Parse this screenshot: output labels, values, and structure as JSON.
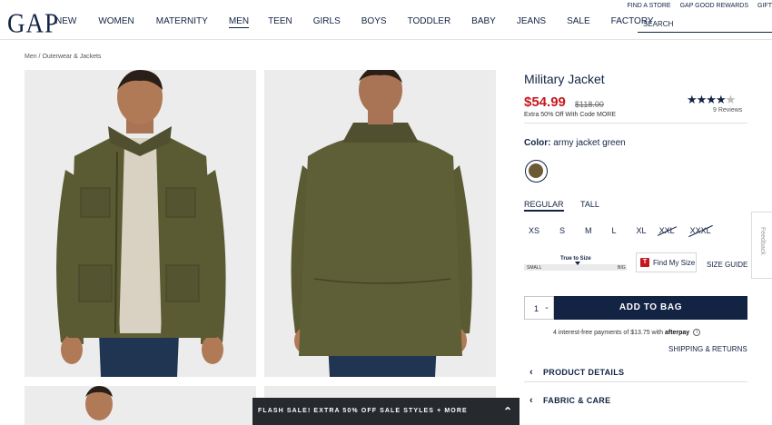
{
  "header": {
    "logo": "GAP",
    "nav": [
      "NEW",
      "WOMEN",
      "MATERNITY",
      "MEN",
      "TEEN",
      "GIRLS",
      "BOYS",
      "TODDLER",
      "BABY",
      "JEANS",
      "SALE",
      "FACTORY"
    ],
    "active_nav": "MEN",
    "top_links": [
      "FIND A STORE",
      "GAP GOOD REWARDS",
      "GIFT"
    ],
    "search_placeholder": "SEARCH"
  },
  "breadcrumb": "Men / Outerwear & Jackets",
  "product": {
    "title": "Military Jacket",
    "price": "$54.99",
    "original_price": "$118.00",
    "promo": "Extra 50% Off With Code MORE",
    "rating": 4.5,
    "reviews": "9 Reviews",
    "color_label": "Color:",
    "color_name": "army jacket green",
    "swatch_color": "#6b5b35",
    "fits": [
      "REGULAR",
      "TALL"
    ],
    "active_fit": "REGULAR",
    "sizes": [
      "XS",
      "S",
      "M",
      "L",
      "XL",
      "XXL",
      "XXXL"
    ],
    "out_of_stock_sizes": [
      "XXL",
      "XXXL"
    ],
    "true_to_size": {
      "label": "True to Size",
      "small": "SMALL",
      "big": "BIG"
    },
    "find_size": "Find My Size",
    "size_guide": "SIZE GUIDE",
    "quantity": "1",
    "add_to_bag": "ADD TO BAG",
    "afterpay_text": "4 interest-free payments of $13.75 with",
    "afterpay_brand": "afterpay",
    "shipping": "SHIPPING & RETURNS",
    "accordions": [
      "PRODUCT DETAILS",
      "FABRIC & CARE"
    ]
  },
  "feedback": "Feedback",
  "flash_banner": "FLASH SALE! EXTRA 50% OFF SALE STYLES + MORE",
  "colors": {
    "navy": "#122344",
    "sale_red": "#c4191f",
    "jacket_green": "#5a5a33"
  }
}
